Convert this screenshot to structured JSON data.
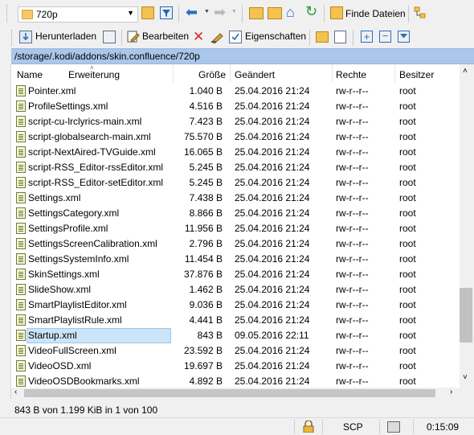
{
  "toolbar": {
    "path_combo_value": "720p",
    "find_files_label": "Finde Dateien"
  },
  "toolbar2": {
    "download_label": "Herunterladen",
    "edit_label": "Bearbeiten",
    "properties_label": "Eigenschaften"
  },
  "path": "/storage/.kodi/addons/skin.confluence/720p",
  "columns": {
    "name": "Name",
    "extension": "Erweiterung",
    "size": "Größe",
    "changed": "Geändert",
    "rights": "Rechte",
    "owner": "Besitzer"
  },
  "files": [
    {
      "name": "Pointer.xml",
      "size": "1.040 B",
      "changed": "25.04.2016 21:24",
      "rights": "rw-r--r--",
      "owner": "root"
    },
    {
      "name": "ProfileSettings.xml",
      "size": "4.516 B",
      "changed": "25.04.2016 21:24",
      "rights": "rw-r--r--",
      "owner": "root"
    },
    {
      "name": "script-cu-lrclyrics-main.xml",
      "size": "7.423 B",
      "changed": "25.04.2016 21:24",
      "rights": "rw-r--r--",
      "owner": "root"
    },
    {
      "name": "script-globalsearch-main.xml",
      "size": "75.570 B",
      "changed": "25.04.2016 21:24",
      "rights": "rw-r--r--",
      "owner": "root"
    },
    {
      "name": "script-NextAired-TVGuide.xml",
      "size": "16.065 B",
      "changed": "25.04.2016 21:24",
      "rights": "rw-r--r--",
      "owner": "root"
    },
    {
      "name": "script-RSS_Editor-rssEditor.xml",
      "size": "5.245 B",
      "changed": "25.04.2016 21:24",
      "rights": "rw-r--r--",
      "owner": "root"
    },
    {
      "name": "script-RSS_Editor-setEditor.xml",
      "size": "5.245 B",
      "changed": "25.04.2016 21:24",
      "rights": "rw-r--r--",
      "owner": "root"
    },
    {
      "name": "Settings.xml",
      "size": "7.438 B",
      "changed": "25.04.2016 21:24",
      "rights": "rw-r--r--",
      "owner": "root"
    },
    {
      "name": "SettingsCategory.xml",
      "size": "8.866 B",
      "changed": "25.04.2016 21:24",
      "rights": "rw-r--r--",
      "owner": "root"
    },
    {
      "name": "SettingsProfile.xml",
      "size": "11.956 B",
      "changed": "25.04.2016 21:24",
      "rights": "rw-r--r--",
      "owner": "root"
    },
    {
      "name": "SettingsScreenCalibration.xml",
      "size": "2.796 B",
      "changed": "25.04.2016 21:24",
      "rights": "rw-r--r--",
      "owner": "root"
    },
    {
      "name": "SettingsSystemInfo.xml",
      "size": "11.454 B",
      "changed": "25.04.2016 21:24",
      "rights": "rw-r--r--",
      "owner": "root"
    },
    {
      "name": "SkinSettings.xml",
      "size": "37.876 B",
      "changed": "25.04.2016 21:24",
      "rights": "rw-r--r--",
      "owner": "root"
    },
    {
      "name": "SlideShow.xml",
      "size": "1.462 B",
      "changed": "25.04.2016 21:24",
      "rights": "rw-r--r--",
      "owner": "root"
    },
    {
      "name": "SmartPlaylistEditor.xml",
      "size": "9.036 B",
      "changed": "25.04.2016 21:24",
      "rights": "rw-r--r--",
      "owner": "root"
    },
    {
      "name": "SmartPlaylistRule.xml",
      "size": "4.441 B",
      "changed": "25.04.2016 21:24",
      "rights": "rw-r--r--",
      "owner": "root"
    },
    {
      "name": "Startup.xml",
      "size": "843 B",
      "changed": "09.05.2016 22:11",
      "rights": "rw-r--r--",
      "owner": "root",
      "selected": true
    },
    {
      "name": "VideoFullScreen.xml",
      "size": "23.592 B",
      "changed": "25.04.2016 21:24",
      "rights": "rw-r--r--",
      "owner": "root"
    },
    {
      "name": "VideoOSD.xml",
      "size": "19.697 B",
      "changed": "25.04.2016 21:24",
      "rights": "rw-r--r--",
      "owner": "root"
    },
    {
      "name": "VideoOSDBookmarks.xml",
      "size": "4.892 B",
      "changed": "25.04.2016 21:24",
      "rights": "rw-r--r--",
      "owner": "root"
    }
  ],
  "status": {
    "selection": "843 B von 1.199 KiB in 1 von 100",
    "protocol": "SCP",
    "time": "0:15:09"
  },
  "colors": {
    "path_bar": "#aac6e8",
    "selection": "#cce4f7"
  }
}
